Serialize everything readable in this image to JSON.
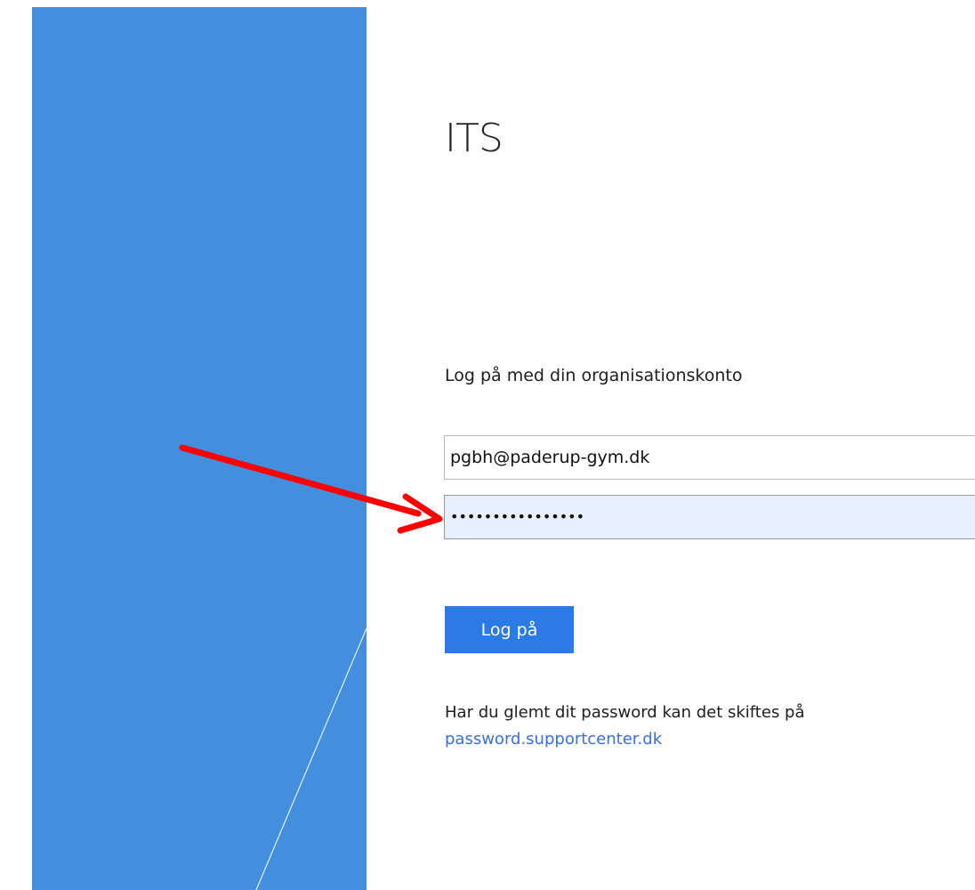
{
  "org": {
    "name": "ITS"
  },
  "login": {
    "prompt": "Log på med din organisationskonto",
    "email_value": "pgbh@paderup-gym.dk",
    "password_value": "••••••••••••••••",
    "button_label": "Log på"
  },
  "forgot": {
    "text": "Har du glemt dit password kan det skiftes på",
    "link_text": "password.supportcenter.dk"
  },
  "colors": {
    "panel": "#448fdd",
    "button": "#2b7ae6",
    "link": "#3b6fd9",
    "arrow": "#ff0000",
    "password_fill": "#e8f0fe"
  },
  "icons": {
    "annotation": "red-arrow-icon"
  }
}
